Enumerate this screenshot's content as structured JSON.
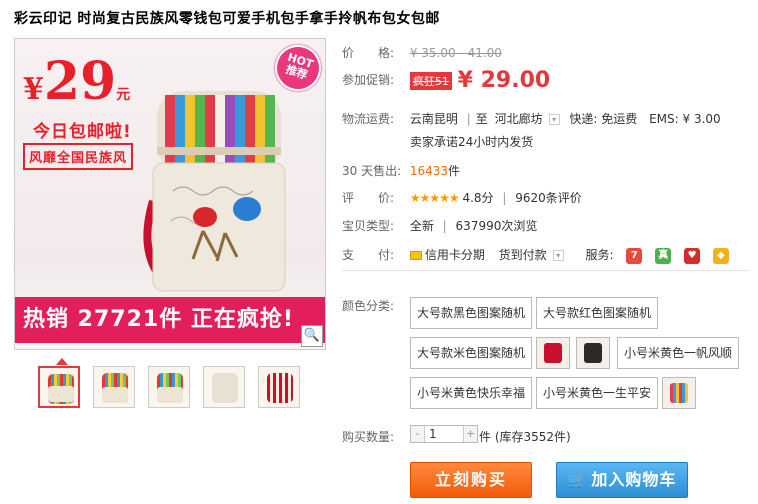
{
  "title": "彩云印记 时尚复古民族风零钱包可爱手机包手拿手拎帆布包女包邮",
  "main_image": {
    "price_symbol": "¥",
    "price_number": "29",
    "price_unit": "元",
    "promo_line": "今日包邮啦!",
    "promo_box": "风靡全国民族风",
    "hot_badge_top": "HOT",
    "hot_badge_bottom": "推荐",
    "sales_banner": "热销 27721件 正在疯抢!",
    "zoom_icon": "magnifier-icon"
  },
  "thumbnails": [
    {
      "label": "thumb-1"
    },
    {
      "label": "thumb-2"
    },
    {
      "label": "thumb-3"
    },
    {
      "label": "thumb-4"
    },
    {
      "label": "thumb-5"
    }
  ],
  "price": {
    "label": "价　　格:",
    "value": "¥ 35.00 - 41.00"
  },
  "promotion": {
    "label": "参加促销:",
    "tag": "疯狂51",
    "price": "¥ 29.00"
  },
  "shipping": {
    "label": "物流运费:",
    "from": "云南昆明",
    "to_prefix": "至",
    "to": "河北廊坊",
    "express": "快递: 免运费",
    "ems": "EMS: ¥ 3.00",
    "promise": "卖家承诺24小时内发货"
  },
  "sales": {
    "label": "30 天售出:",
    "count": "16433",
    "unit": "件"
  },
  "rating": {
    "label": "评　　价:",
    "stars": "★★★★★",
    "score": "4.8分",
    "reviews": "9620条评价"
  },
  "type": {
    "label": "宝贝类型:",
    "value": "全新",
    "views": "637990次浏览"
  },
  "payment": {
    "label": "支　　付:",
    "credit": "信用卡分期",
    "cod": "货到付款",
    "service_label": "服务:",
    "service_icons": [
      "seven-day-return-icon",
      "genuine-guarantee-icon",
      "heart-service-icon",
      "shield-guarantee-icon"
    ]
  },
  "colors": {
    "label": "颜色分类:",
    "options": [
      "大号款黑色图案随机",
      "大号款红色图案随机",
      "大号款米色图案随机",
      "",
      "",
      "小号米黄色一帆风顺",
      "小号米黄色快乐幸福",
      "小号米黄色一生平安",
      ""
    ]
  },
  "quantity": {
    "label": "购买数量:",
    "minus": "-",
    "value": "1",
    "plus": "+",
    "unit": "件 (库存3552件)"
  },
  "buttons": {
    "buy": "立刻购买",
    "cart": "加入购物车"
  },
  "colors_hex": {
    "accent_red": "#e4393c",
    "buy_orange": "#f25b0c",
    "cart_blue": "#2d8fd3",
    "banner_pink": "#e21f5a"
  }
}
